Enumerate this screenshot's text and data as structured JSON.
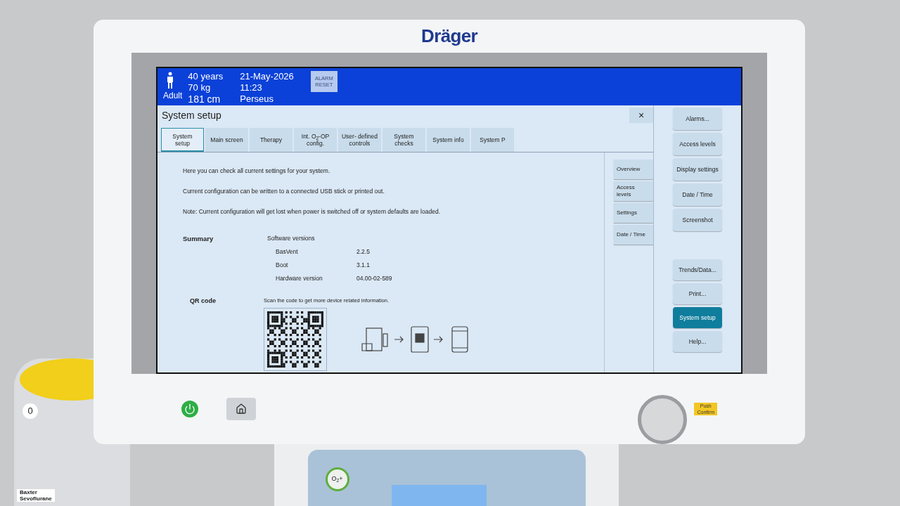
{
  "device": {
    "brand": "Dräger",
    "knob_label": [
      "Push",
      "Confirm"
    ],
    "o2_button": "O$_{2}$+"
  },
  "vaporizer": {
    "dial": "0",
    "label": [
      "Baxter",
      "Sevoflurane"
    ]
  },
  "patient": {
    "age": "40 years",
    "weight": "70 kg",
    "category": "Adult",
    "height": "181 cm",
    "date": "21-May-2026",
    "time": "11:23",
    "name": "Perseus"
  },
  "alarm_reset": "ALARM RESET",
  "dialog": {
    "title": "System setup",
    "close": "×"
  },
  "tabs": [
    {
      "label": "System setup",
      "selected": true
    },
    {
      "label": "Main screen",
      "selected": false
    },
    {
      "label": "Therapy",
      "selected": false
    },
    {
      "label": "Int. O$_{2}$-OP config.",
      "selected": false
    },
    {
      "label": "User- defined controls",
      "selected": false
    },
    {
      "label": "System checks",
      "selected": false
    },
    {
      "label": "System info",
      "selected": false
    },
    {
      "label": "System P",
      "selected": false
    }
  ],
  "intro": [
    "Here you can check all current settings for your system.",
    "Current configuration can be written to a connected USB stick or printed out.",
    "Note: Current configuration will get lost when power is switched off or system defaults are loaded."
  ],
  "summary": {
    "heading": "Summary",
    "subheading": "Software versions",
    "rows": [
      {
        "name": "BasVent",
        "value": "2.2.5"
      },
      {
        "name": "Boot",
        "value": "3.1.1"
      },
      {
        "name": "Hardware version",
        "value": "04.00-02-589"
      }
    ]
  },
  "qr": {
    "heading": "QR code",
    "caption": "Scan the code to get more device related information."
  },
  "section_nav": [
    "Overview",
    "Access levels",
    "Settings",
    "Date / Time"
  ],
  "sidebar": {
    "top": [
      {
        "label": "Alarms...",
        "selected": false
      },
      {
        "label": "Access levels",
        "selected": false
      },
      {
        "label": "Display settings",
        "selected": false
      },
      {
        "label": "Date / Time",
        "selected": false
      },
      {
        "label": "Screenshot",
        "selected": false
      }
    ],
    "bottom": [
      {
        "label": "Trends/Data...",
        "selected": false
      },
      {
        "label": "Print...",
        "selected": false
      },
      {
        "label": "System setup",
        "selected": true
      },
      {
        "label": "Help...",
        "selected": false
      }
    ]
  }
}
